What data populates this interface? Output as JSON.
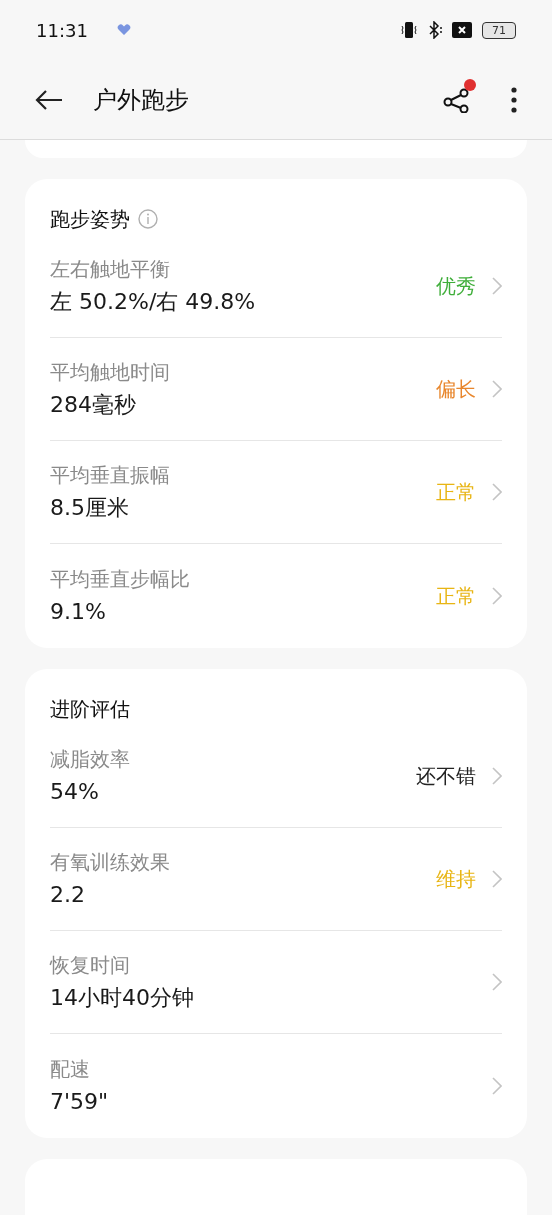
{
  "status_bar": {
    "time": "11:31",
    "battery": "71"
  },
  "header": {
    "title": "户外跑步",
    "share_badge": true
  },
  "sections": [
    {
      "title": "跑步姿势",
      "info": true,
      "rows": [
        {
          "label": "左右触地平衡",
          "value": "左 50.2%/右 49.8%",
          "status": "优秀",
          "color": "#3fae3a"
        },
        {
          "label": "平均触地时间",
          "value": "284毫秒",
          "status": "偏长",
          "color": "#e8862c"
        },
        {
          "label": "平均垂直振幅",
          "value": "8.5厘米",
          "status": "正常",
          "color": "#e8b514"
        },
        {
          "label": "平均垂直步幅比",
          "value": "9.1%",
          "status": "正常",
          "color": "#e8b514"
        }
      ]
    },
    {
      "title": "进阶评估",
      "info": false,
      "rows": [
        {
          "label": "减脂效率",
          "value": "54%",
          "status": "还不错",
          "color": "#222222"
        },
        {
          "label": "有氧训练效果",
          "value": "2.2",
          "status": "维持",
          "color": "#e8b514"
        },
        {
          "label": "恢复时间",
          "value": "14小时40分钟"
        },
        {
          "label": "配速",
          "value": "7'59\""
        }
      ]
    }
  ]
}
